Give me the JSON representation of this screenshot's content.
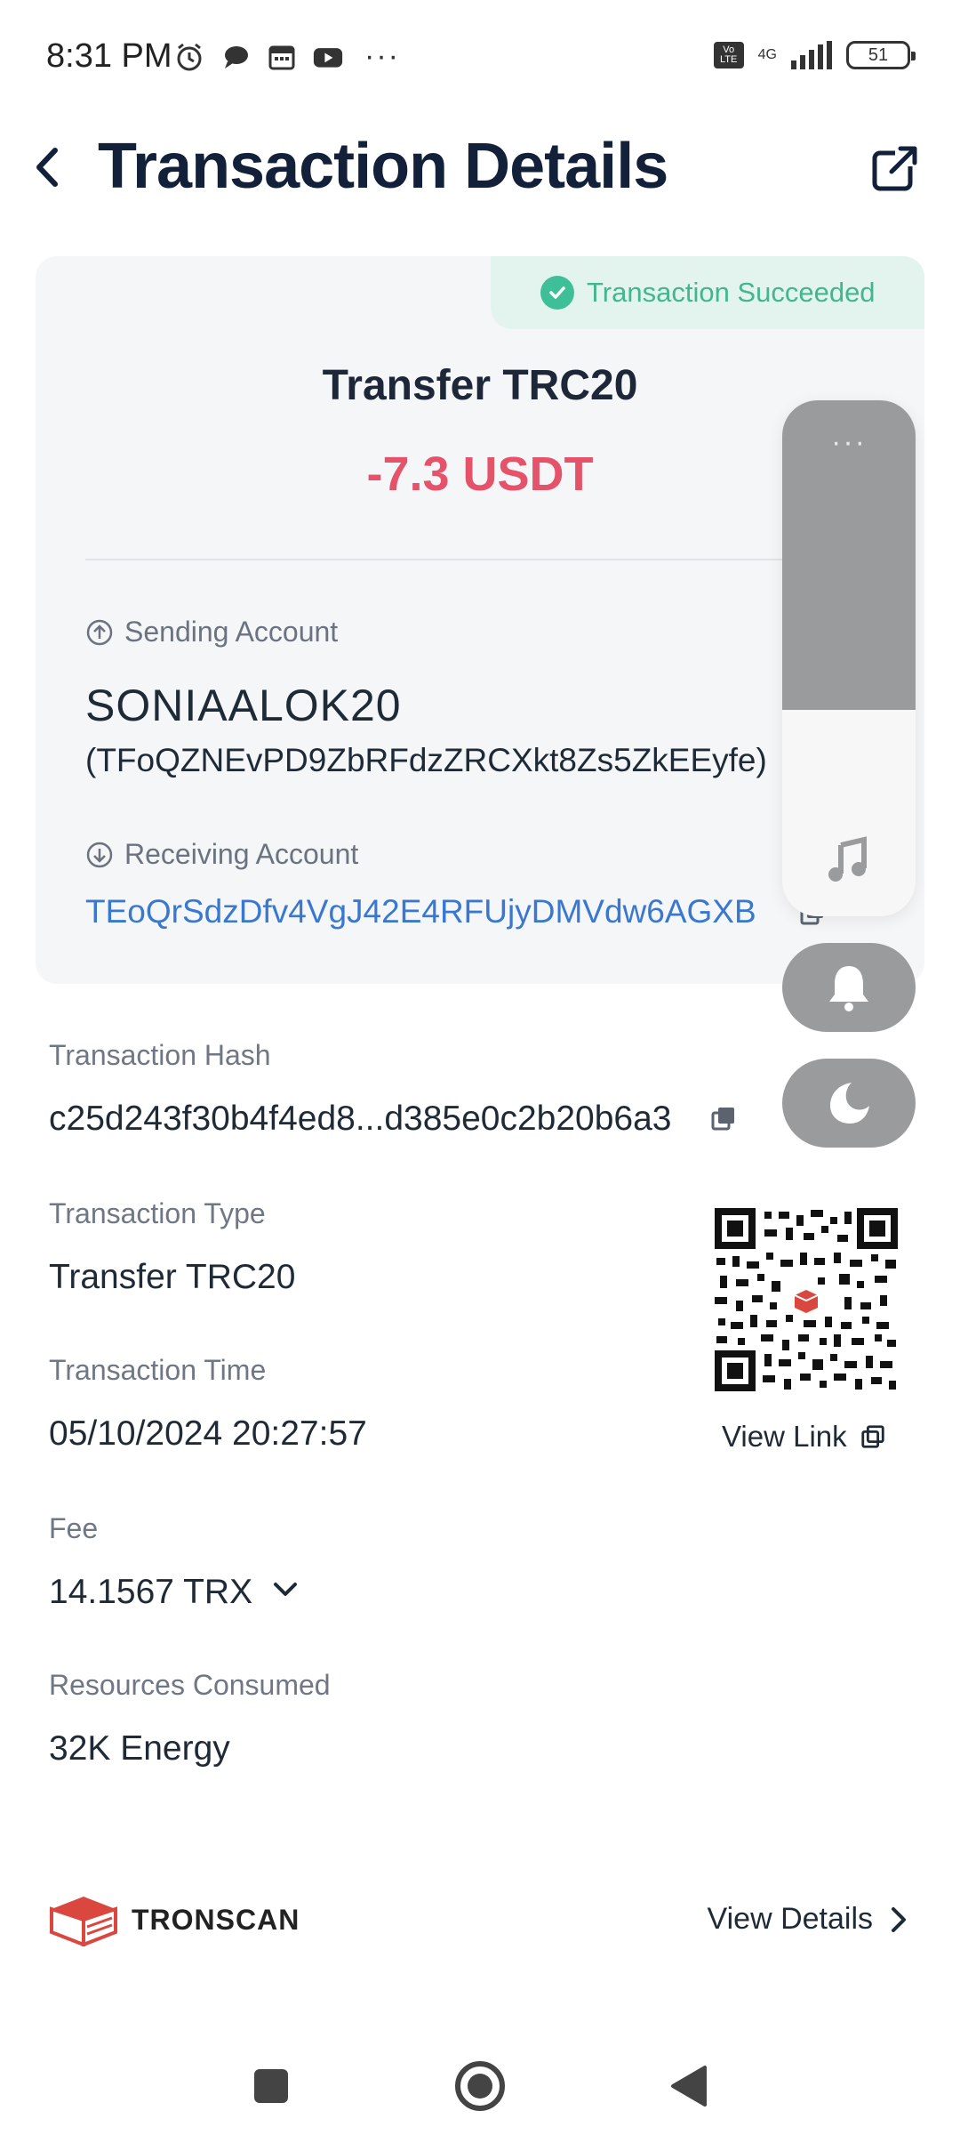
{
  "status_bar": {
    "time": "8:31 PM",
    "more": "···",
    "volte": "Vo LTE",
    "network": "4G",
    "battery": "51"
  },
  "header": {
    "title": "Transaction Details"
  },
  "summary": {
    "status": "Transaction Succeeded",
    "title": "Transfer TRC20",
    "amount": "-7.3 USDT",
    "sending_label": "Sending Account",
    "sending_name": "SONIAALOK20",
    "sending_address": "(TFoQZNEvPD9ZbRFdzZRCXkt8Zs5ZkEEyfe)",
    "receiving_label": "Receiving Account",
    "receiving_address": "TEoQrSdzDfv4VgJ42E4RFUjyDMVdw6AGXB"
  },
  "details": {
    "hash_label": "Transaction Hash",
    "hash_value": "c25d243f30b4f4ed8...d385e0c2b20b6a3",
    "type_label": "Transaction Type",
    "type_value": "Transfer TRC20",
    "time_label": "Transaction Time",
    "time_value": "05/10/2024 20:27:57",
    "fee_label": "Fee",
    "fee_value": "14.1567 TRX",
    "resources_label": "Resources Consumed",
    "resources_value": "32K Energy",
    "view_link": "View Link"
  },
  "footer": {
    "brand": "TRONSCAN",
    "view_details": "View Details"
  },
  "floating_panel": {
    "dots": "···"
  },
  "colors": {
    "accent_red": "#e5536b",
    "success_green": "#43b58f",
    "link_blue": "#3a78d0"
  }
}
